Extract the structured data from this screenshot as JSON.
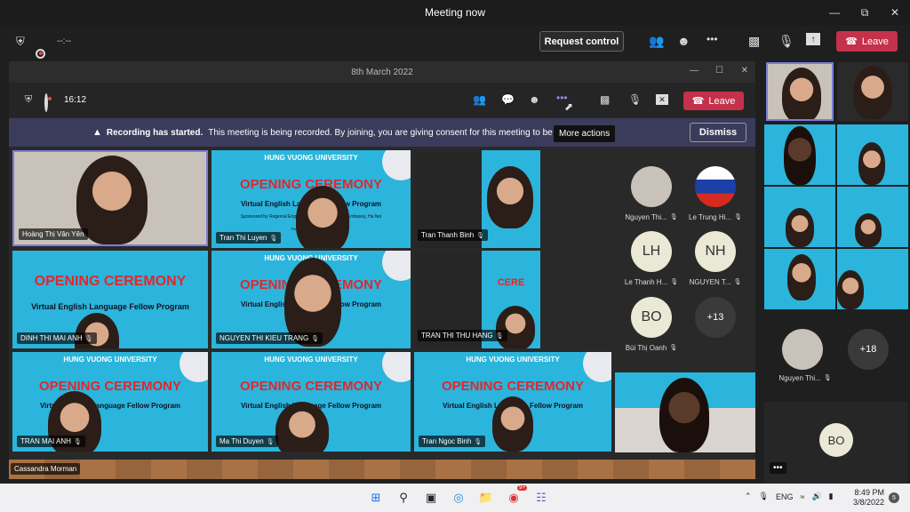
{
  "outer_window": {
    "title": "Meeting now",
    "timer": "--:--"
  },
  "outer_toolbar": {
    "request_control": "Request control",
    "leave": "Leave",
    "more": "•••"
  },
  "inner_window": {
    "title": "8th March 2022",
    "timer": "16:12",
    "leave": "Leave",
    "tooltip": "More actions"
  },
  "banner": {
    "bold": "Recording has started.",
    "text": "This meeting is being recorded. By joining, you are giving consent for this meeting to be recorded",
    "dismiss": "Dismiss"
  },
  "slide": {
    "university": "HUNG VUONG UNIVERSITY",
    "ceremony": "OPENING CEREMONY",
    "program": "Virtual English Language Fellow Program",
    "sponsor": "Sponsored by Regional English Language Office, U.S Embassy, Ha Noi",
    "date": "Phu Tho, March 8th 2022"
  },
  "tiles": [
    {
      "name": "Hoàng Thị Vân Yên"
    },
    {
      "name": "Tran Thi Luyen"
    },
    {
      "name": "Tran Thanh Binh"
    },
    {
      "name": "DINH THI MAI ANH"
    },
    {
      "name": "NGUYEN THI KIEU TRANG"
    },
    {
      "name": "TRAN THI THU HANG"
    },
    {
      "name": "TRAN MAI ANH"
    },
    {
      "name": "Ma Thi Duyen"
    },
    {
      "name": "Tran Ngoc Binh"
    },
    {
      "name": "Cassandra Morman"
    }
  ],
  "avatars": [
    {
      "initials": "",
      "name": "Nguyen Thi..."
    },
    {
      "initials": "",
      "name": "Le Trung Hi..."
    },
    {
      "initials": "LH",
      "name": "Le Thanh H..."
    },
    {
      "initials": "NH",
      "name": "NGUYEN T..."
    },
    {
      "initials": "BO",
      "name": "Bùi Thị Oanh"
    },
    {
      "initials": "+13",
      "name": ""
    }
  ],
  "right_panel": {
    "avatar_name": "Nguyen Thi...",
    "more_count": "+18",
    "bo_initials": "BO",
    "more": "•••"
  },
  "taskbar": {
    "lang": "ENG",
    "time": "8:49 PM",
    "date": "3/8/2022",
    "badge": "9+"
  },
  "colors": {
    "leave": "#c4314b",
    "banner": "#3b3c5c",
    "slide": "#2bb5dc",
    "ceremony_red": "#e3262c"
  }
}
